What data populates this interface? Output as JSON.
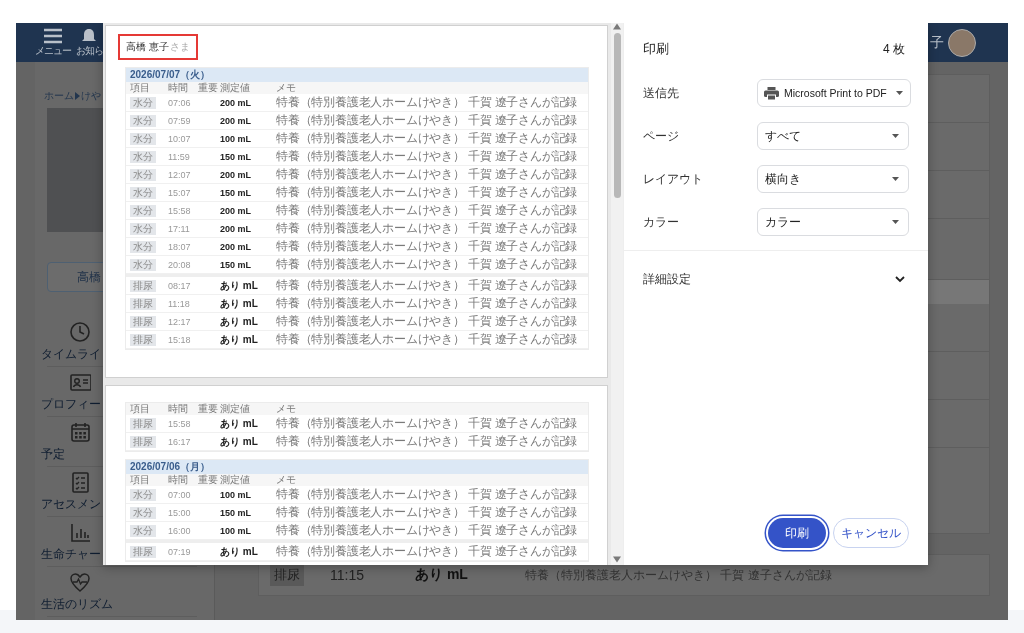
{
  "app": {
    "header": {
      "menu_label": "メニュー",
      "notice_label": "お知ら",
      "user_name": "子"
    },
    "sidebar": {
      "breadcrumb": [
        "ホーム",
        "けや"
      ],
      "name_button": "高橋",
      "nav": [
        {
          "label": "タイムライ"
        },
        {
          "label": "プロフィー"
        },
        {
          "label": "予定"
        },
        {
          "label": "アセスメン"
        },
        {
          "label": "生命チャー"
        },
        {
          "label": "生活のリズム"
        }
      ]
    },
    "record_row": {
      "category": "排尿",
      "time": "11:15",
      "value": "あり mL",
      "memo": "特養（特別養護老人ホームけやき） 千賀 遼子さんが記録"
    }
  },
  "print_dialog": {
    "preview": {
      "pages": [
        {
          "name": "高橋 恵子",
          "honorific": "さま",
          "name_highlighted": true,
          "sections": [
            {
              "date": "2026/07/07（火）",
              "columns": [
                "項目",
                "時間",
                "重要",
                "測定値",
                "メモ"
              ],
              "groups": [
                {
                  "rows": [
                    {
                      "category": "水分",
                      "time": "07:06",
                      "value": "200 mL",
                      "memo": "特養（特別養護老人ホームけやき） 千賀 遼子さんが記録"
                    },
                    {
                      "category": "水分",
                      "time": "07:59",
                      "value": "200 mL",
                      "memo": "特養（特別養護老人ホームけやき） 千賀 遼子さんが記録"
                    },
                    {
                      "category": "水分",
                      "time": "10:07",
                      "value": "100 mL",
                      "memo": "特養（特別養護老人ホームけやき） 千賀 遼子さんが記録"
                    },
                    {
                      "category": "水分",
                      "time": "11:59",
                      "value": "150 mL",
                      "memo": "特養（特別養護老人ホームけやき） 千賀 遼子さんが記録"
                    },
                    {
                      "category": "水分",
                      "time": "12:07",
                      "value": "200 mL",
                      "memo": "特養（特別養護老人ホームけやき） 千賀 遼子さんが記録"
                    },
                    {
                      "category": "水分",
                      "time": "15:07",
                      "value": "150 mL",
                      "memo": "特養（特別養護老人ホームけやき） 千賀 遼子さんが記録"
                    },
                    {
                      "category": "水分",
                      "time": "15:58",
                      "value": "200 mL",
                      "memo": "特養（特別養護老人ホームけやき） 千賀 遼子さんが記録"
                    },
                    {
                      "category": "水分",
                      "time": "17:11",
                      "value": "200 mL",
                      "memo": "特養（特別養護老人ホームけやき） 千賀 遼子さんが記録"
                    },
                    {
                      "category": "水分",
                      "time": "18:07",
                      "value": "200 mL",
                      "memo": "特養（特別養護老人ホームけやき） 千賀 遼子さんが記録"
                    },
                    {
                      "category": "水分",
                      "time": "20:08",
                      "value": "150 mL",
                      "memo": "特養（特別養護老人ホームけやき） 千賀 遼子さんが記録"
                    }
                  ]
                },
                {
                  "rows": [
                    {
                      "category": "排尿",
                      "time": "08:17",
                      "value": "あり mL",
                      "memo": "特養（特別養護老人ホームけやき） 千賀 遼子さんが記録"
                    },
                    {
                      "category": "排尿",
                      "time": "11:18",
                      "value": "あり mL",
                      "memo": "特養（特別養護老人ホームけやき） 千賀 遼子さんが記録"
                    },
                    {
                      "category": "排尿",
                      "time": "12:17",
                      "value": "あり mL",
                      "memo": "特養（特別養護老人ホームけやき） 千賀 遼子さんが記録"
                    },
                    {
                      "category": "排尿",
                      "time": "15:18",
                      "value": "あり mL",
                      "memo": "特養（特別養護老人ホームけやき） 千賀 遼子さんが記録"
                    }
                  ]
                }
              ]
            }
          ]
        },
        {
          "sections": [
            {
              "columns": [
                "項目",
                "時間",
                "重要",
                "測定値",
                "メモ"
              ],
              "groups": [
                {
                  "rows": [
                    {
                      "category": "排尿",
                      "time": "15:58",
                      "value": "あり mL",
                      "memo": "特養（特別養護老人ホームけやき） 千賀 遼子さんが記録"
                    },
                    {
                      "category": "排尿",
                      "time": "16:17",
                      "value": "あり mL",
                      "memo": "特養（特別養護老人ホームけやき） 千賀 遼子さんが記録"
                    }
                  ]
                }
              ]
            },
            {
              "date": "2026/07/06（月）",
              "columns": [
                "項目",
                "時間",
                "重要",
                "測定値",
                "メモ"
              ],
              "groups": [
                {
                  "rows": [
                    {
                      "category": "水分",
                      "time": "07:00",
                      "value": "100 mL",
                      "memo": "特養（特別養護老人ホームけやき） 千賀 遼子さんが記録"
                    },
                    {
                      "category": "水分",
                      "time": "15:00",
                      "value": "150 mL",
                      "memo": "特養（特別養護老人ホームけやき） 千賀 遼子さんが記録"
                    },
                    {
                      "category": "水分",
                      "time": "16:00",
                      "value": "100 mL",
                      "memo": "特養（特別養護老人ホームけやき） 千賀 遼子さんが記録"
                    }
                  ]
                },
                {
                  "rows": [
                    {
                      "category": "排尿",
                      "time": "07:19",
                      "value": "あり mL",
                      "memo": "特養（特別養護老人ホームけやき） 千賀 遼子さんが記録"
                    }
                  ]
                }
              ]
            }
          ]
        }
      ]
    },
    "settings": {
      "title": "印刷",
      "sheet_count": "4 枚",
      "fields": [
        {
          "label": "送信先",
          "value": "Microsoft Print to PDF",
          "kind": "destination"
        },
        {
          "label": "ページ",
          "value": "すべて",
          "kind": "select"
        },
        {
          "label": "レイアウト",
          "value": "横向き",
          "kind": "select"
        },
        {
          "label": "カラー",
          "value": "カラー",
          "kind": "select"
        }
      ],
      "advanced": {
        "label": "詳細設定",
        "expanded": false
      },
      "buttons": [
        {
          "label": "印刷",
          "kind": "primary"
        },
        {
          "label": "キャンセル",
          "kind": "secondary"
        }
      ]
    }
  }
}
